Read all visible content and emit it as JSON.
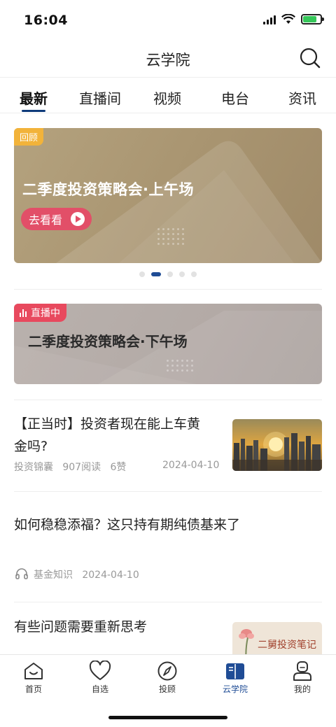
{
  "status_bar": {
    "time": "16:04"
  },
  "header": {
    "title": "云学院",
    "search_icon": "search-icon"
  },
  "tabs": [
    {
      "label": "最新",
      "active": true
    },
    {
      "label": "直播间",
      "active": false
    },
    {
      "label": "视频",
      "active": false
    },
    {
      "label": "电台",
      "active": false
    },
    {
      "label": "资讯",
      "active": false
    }
  ],
  "banner": {
    "tag": "回顾",
    "title": "二季度投资策略会·上午场",
    "button_label": "去看看",
    "pager_total": 5,
    "pager_active_index": 1
  },
  "live_card": {
    "tag": "直播中",
    "title": "二季度投资策略会·下午场"
  },
  "articles": [
    {
      "title": "【正当时】投资者现在能上车黄金吗?",
      "source": "投资锦囊",
      "reads": "907阅读",
      "likes": "6赞",
      "date": "2024-04-10",
      "thumbnail": "city-sunset"
    },
    {
      "title": "如何稳稳添福？这只持有期纯债基来了",
      "source": "基金知识",
      "date": "2024-04-10",
      "icon": "headphones-icon"
    },
    {
      "title": "有些问题需要重新思考",
      "thumbnail_caption": "二舅投资笔记"
    }
  ],
  "bottom_nav": [
    {
      "label": "首页",
      "icon": "home-icon",
      "active": false
    },
    {
      "label": "自选",
      "icon": "heart-icon",
      "active": false
    },
    {
      "label": "投顾",
      "icon": "compass-icon",
      "active": false
    },
    {
      "label": "云学院",
      "icon": "book-icon",
      "active": true
    },
    {
      "label": "我的",
      "icon": "user-icon",
      "active": false
    }
  ],
  "colors": {
    "accent": "#1f4c95",
    "live_red": "#e8495e",
    "review_orange": "#f2b33a"
  }
}
